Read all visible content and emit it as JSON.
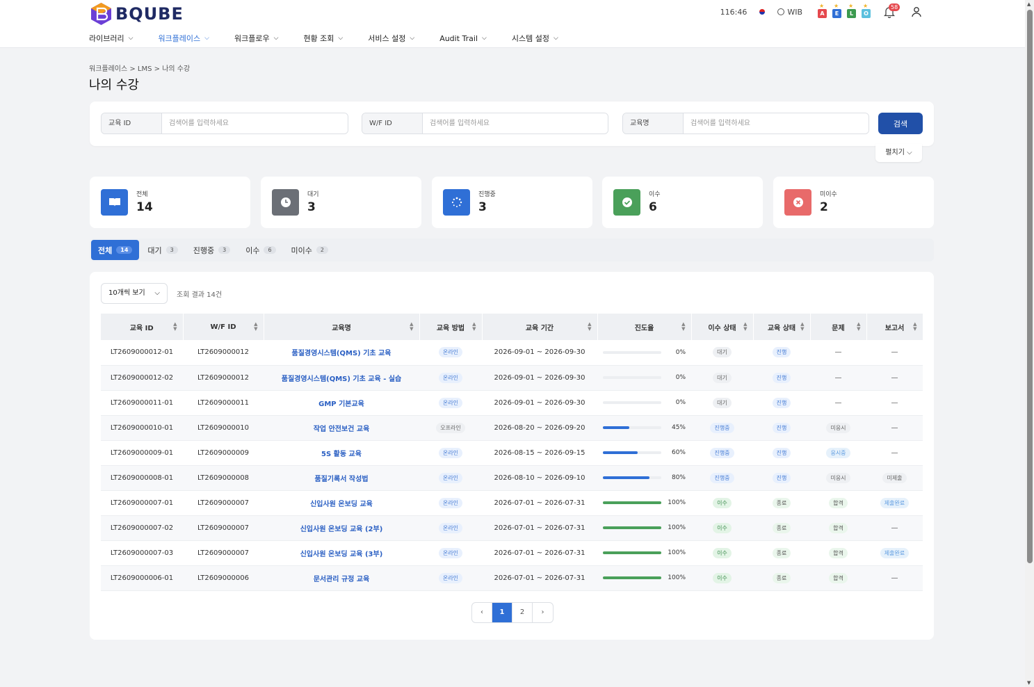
{
  "header": {
    "brand": "BQUBE",
    "time": "116:46",
    "timezone": "WIB",
    "badges": [
      {
        "letter": "A",
        "color": "#e5484d"
      },
      {
        "letter": "E",
        "color": "#2f6fd6"
      },
      {
        "letter": "L",
        "color": "#3c9a4f"
      },
      {
        "letter": "O",
        "color": "#5bc0de"
      }
    ],
    "notification_count": "58",
    "nav": [
      {
        "label": "라이브러리"
      },
      {
        "label": "워크플레이스"
      },
      {
        "label": "워크플로우"
      },
      {
        "label": "현황 조회"
      },
      {
        "label": "서비스 설정"
      },
      {
        "label": "Audit Trail"
      },
      {
        "label": "시스템 설정"
      }
    ]
  },
  "breadcrumb": "워크플레이스 > LMS > 나의 수강",
  "page_title": "나의 수강",
  "search": {
    "fields": [
      {
        "label": "교육 ID",
        "placeholder": "검색어를 입력하세요"
      },
      {
        "label": "W/F ID",
        "placeholder": "검색어를 입력하세요"
      },
      {
        "label": "교육명",
        "placeholder": "검색어를 입력하세요"
      }
    ],
    "button": "검색",
    "expand": "펼치기"
  },
  "stats": [
    {
      "label": "전체",
      "value": "14",
      "color": "#2f6fd6",
      "icon": "book-icon"
    },
    {
      "label": "대기",
      "value": "3",
      "color": "#6b6f76",
      "icon": "clock-icon"
    },
    {
      "label": "진행중",
      "value": "3",
      "color": "#2f6fd6",
      "icon": "spinner-icon"
    },
    {
      "label": "이수",
      "value": "6",
      "color": "#4aa05a",
      "icon": "check-icon"
    },
    {
      "label": "미이수",
      "value": "2",
      "color": "#e86a6a",
      "icon": "x-icon"
    }
  ],
  "tabs": [
    {
      "label": "전체",
      "count": "14"
    },
    {
      "label": "대기",
      "count": "3"
    },
    {
      "label": "진행중",
      "count": "3"
    },
    {
      "label": "이수",
      "count": "6"
    },
    {
      "label": "미이수",
      "count": "2"
    }
  ],
  "table": {
    "page_size": "10개씩 보기",
    "result_text": "조회 결과 14건",
    "columns": [
      "교육 ID",
      "W/F ID",
      "교육명",
      "교육 방법",
      "교육 기간",
      "진도율",
      "이수 상태",
      "교육 상태",
      "문제",
      "보고서"
    ],
    "rows": [
      {
        "id": "LT2609000012-01",
        "wf": "LT2609000012",
        "name": "품질경영시스템(QMS) 기초 교육",
        "method": "온라인",
        "period": "2026-09-01 ~ 2026-09-30",
        "progress": 0,
        "progress_text": "0%",
        "completion": "대기",
        "status": "진행",
        "quiz": "—",
        "report": "—"
      },
      {
        "id": "LT2609000012-02",
        "wf": "LT2609000012",
        "name": "품질경영시스템(QMS) 기초 교육 - 실습",
        "method": "온라인",
        "period": "2026-09-01 ~ 2026-09-30",
        "progress": 0,
        "progress_text": "0%",
        "completion": "대기",
        "status": "진행",
        "quiz": "—",
        "report": "—"
      },
      {
        "id": "LT2609000011-01",
        "wf": "LT2609000011",
        "name": "GMP 기본교육",
        "method": "온라인",
        "period": "2026-09-01 ~ 2026-09-30",
        "progress": 0,
        "progress_text": "0%",
        "completion": "대기",
        "status": "진행",
        "quiz": "—",
        "report": "—"
      },
      {
        "id": "LT2609000010-01",
        "wf": "LT2609000010",
        "name": "작업 안전보건 교육",
        "method": "오프라인",
        "period": "2026-08-20 ~ 2026-09-20",
        "progress": 45,
        "progress_text": "45%",
        "completion": "진행중",
        "status": "진행",
        "quiz": "미응시",
        "report": "—"
      },
      {
        "id": "LT2609000009-01",
        "wf": "LT2609000009",
        "name": "5S 활동 교육",
        "method": "온라인",
        "period": "2026-08-15 ~ 2026-09-15",
        "progress": 60,
        "progress_text": "60%",
        "completion": "진행중",
        "status": "진행",
        "quiz": "응시중",
        "report": "—"
      },
      {
        "id": "LT2609000008-01",
        "wf": "LT2609000008",
        "name": "품질기록서 작성법",
        "method": "온라인",
        "period": "2026-08-10 ~ 2026-09-10",
        "progress": 80,
        "progress_text": "80%",
        "completion": "진행중",
        "status": "진행",
        "quiz": "미응시",
        "report": "미제출"
      },
      {
        "id": "LT2609000007-01",
        "wf": "LT2609000007",
        "name": "신입사원 온보딩 교육",
        "method": "온라인",
        "period": "2026-07-01 ~ 2026-07-31",
        "progress": 100,
        "progress_text": "100%",
        "completion": "이수",
        "status": "종료",
        "quiz": "합격",
        "report": "제출완료"
      },
      {
        "id": "LT2609000007-02",
        "wf": "LT2609000007",
        "name": "신입사원 온보딩 교육 (2부)",
        "method": "온라인",
        "period": "2026-07-01 ~ 2026-07-31",
        "progress": 100,
        "progress_text": "100%",
        "completion": "이수",
        "status": "종료",
        "quiz": "합격",
        "report": "—"
      },
      {
        "id": "LT2609000007-03",
        "wf": "LT2609000007",
        "name": "신입사원 온보딩 교육 (3부)",
        "method": "온라인",
        "period": "2026-07-01 ~ 2026-07-31",
        "progress": 100,
        "progress_text": "100%",
        "completion": "이수",
        "status": "종료",
        "quiz": "합격",
        "report": "제출완료"
      },
      {
        "id": "LT2609000006-01",
        "wf": "LT2609000006",
        "name": "문서관리 규정 교육",
        "method": "온라인",
        "period": "2026-07-01 ~ 2026-07-31",
        "progress": 100,
        "progress_text": "100%",
        "completion": "이수",
        "status": "종료",
        "quiz": "합격",
        "report": "—"
      }
    ]
  },
  "pagination": {
    "prev": "‹",
    "pages": [
      "1",
      "2"
    ],
    "current": "1",
    "next": "›"
  }
}
